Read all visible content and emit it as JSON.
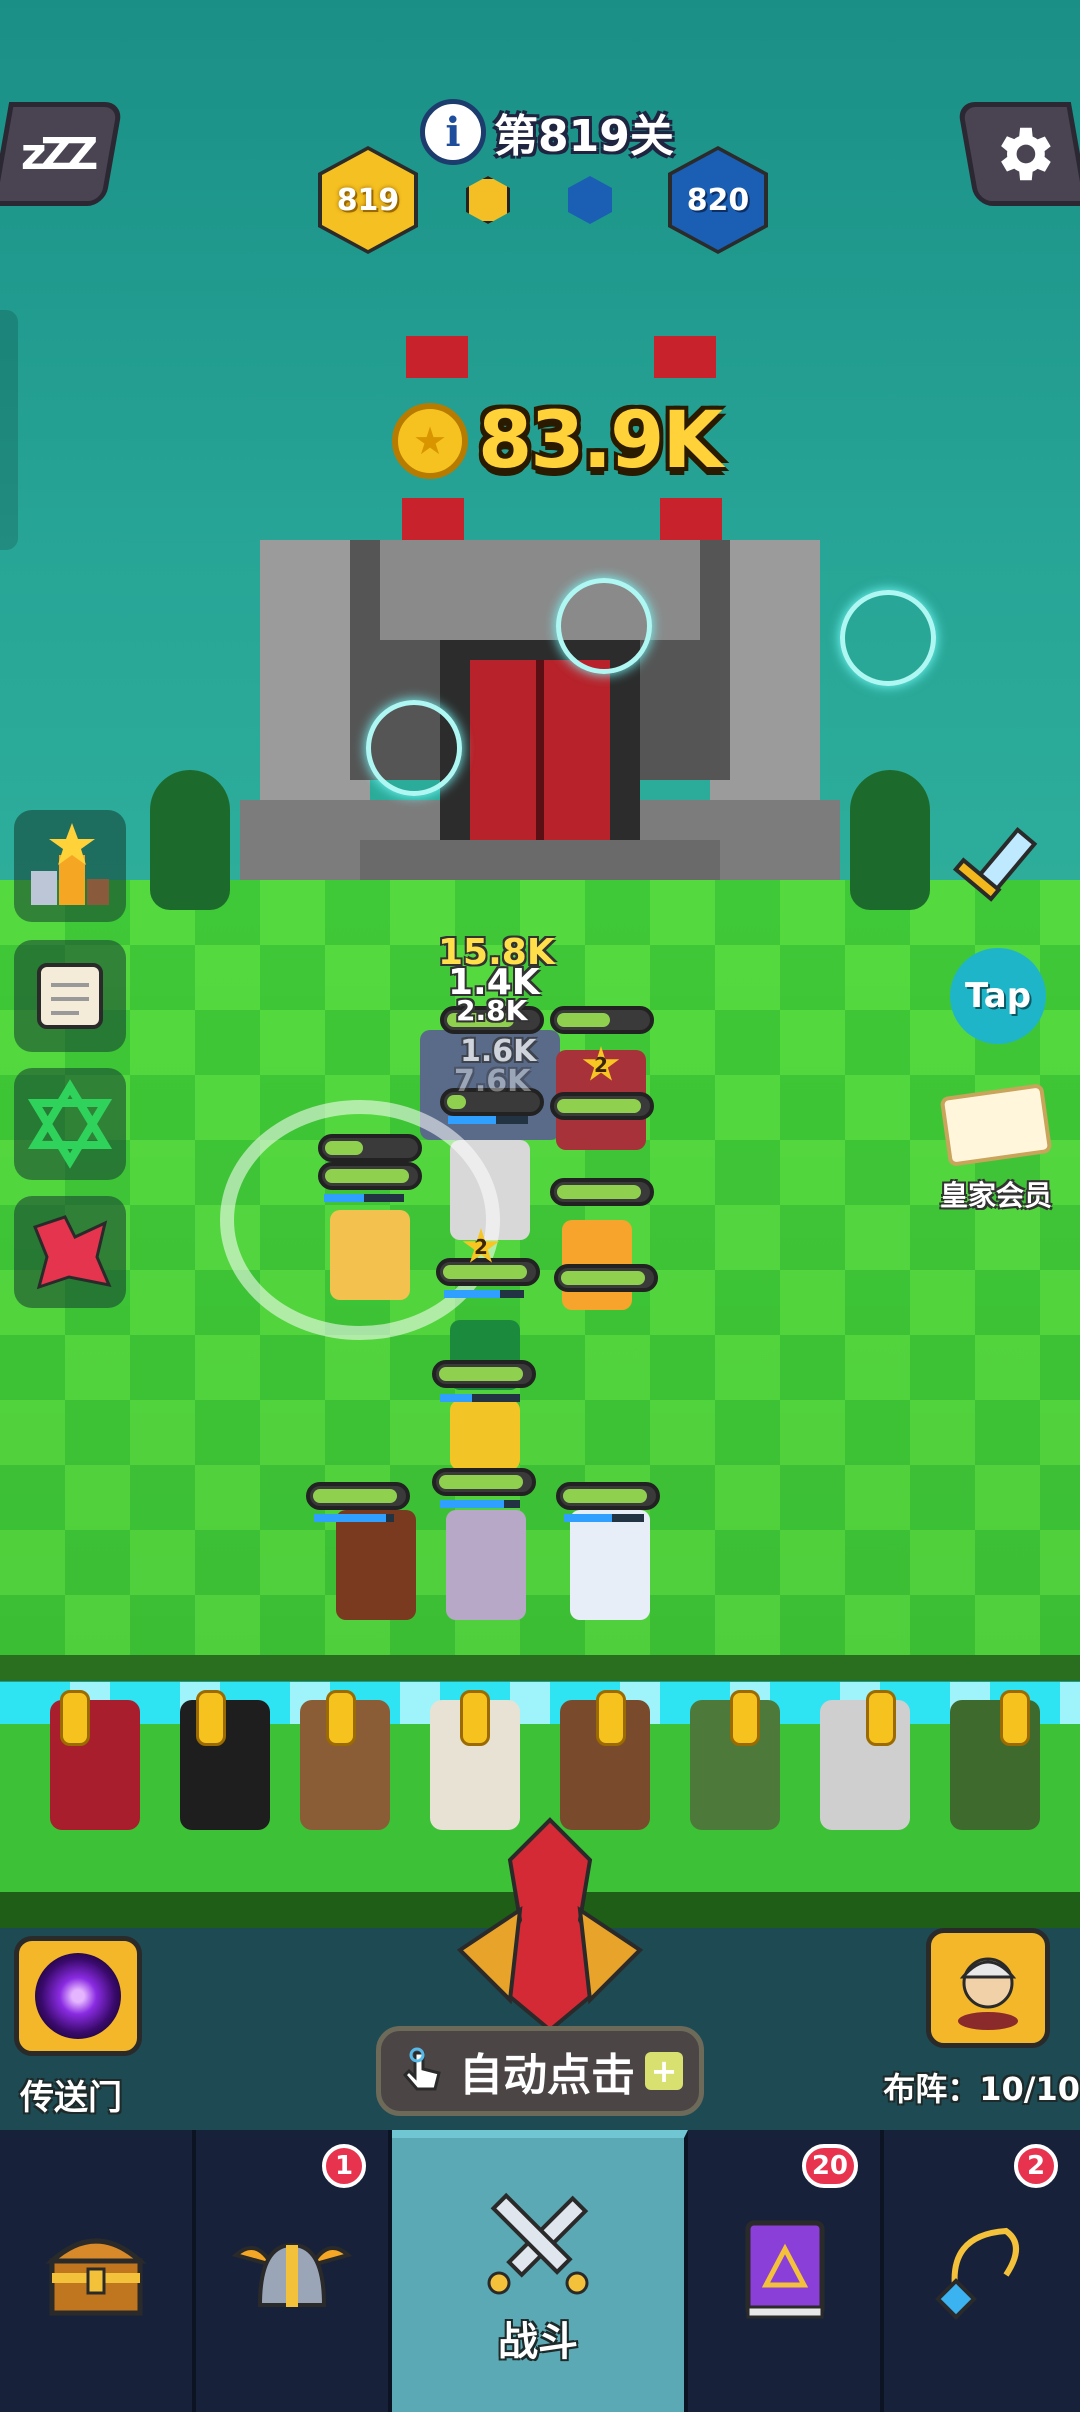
{
  "header": {
    "sleep_icon_text": "zZZ",
    "level_text": "第819关",
    "info_symbol": "i",
    "player_level": "819",
    "enemy_level": "820"
  },
  "gold": {
    "amount": "83.9K"
  },
  "damage_numbers": [
    "15.8K",
    "1.4K",
    "2.8K",
    "1.6K",
    "7.6K"
  ],
  "star_levels": [
    "2",
    "2"
  ],
  "side_menu": {
    "tap_label": "Tap",
    "royal_label": "皇家会员"
  },
  "actions": {
    "portal_label": "传送门",
    "formation_label": "布阵：",
    "formation_count": "10/10",
    "auto_click_label": "自动点击",
    "auto_click_plus": "+"
  },
  "nav": {
    "items": [
      {
        "name": "treasure",
        "badge": ""
      },
      {
        "name": "heroes",
        "badge": "1"
      },
      {
        "name": "battle",
        "label": "战斗",
        "badge": ""
      },
      {
        "name": "spellbook",
        "badge": "20"
      },
      {
        "name": "artifact",
        "badge": "2"
      }
    ]
  },
  "colors": {
    "field_light": "#54da3f",
    "field_dark": "#3fc837",
    "sky": "#1f9a8f",
    "gold": "#ffd23a",
    "nav_bg": "#17223a",
    "nav_active": "#5aa9b4",
    "badge": "#e8334f"
  }
}
